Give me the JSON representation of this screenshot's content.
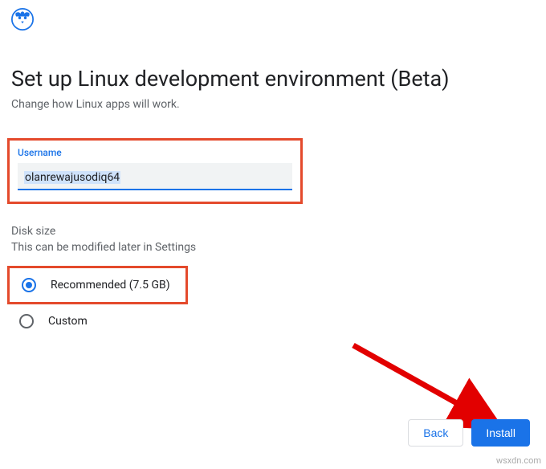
{
  "header": {
    "title": "Set up Linux development environment (Beta)",
    "subtitle": "Change how Linux apps will work."
  },
  "username": {
    "label": "Username",
    "value": "olanrewajusodiq64"
  },
  "disk": {
    "label": "Disk size",
    "sub": "This can be modified later in Settings",
    "options": {
      "recommended": "Recommended (7.5 GB)",
      "custom": "Custom"
    }
  },
  "footer": {
    "back": "Back",
    "install": "Install"
  },
  "watermark": "wsxdn.com"
}
